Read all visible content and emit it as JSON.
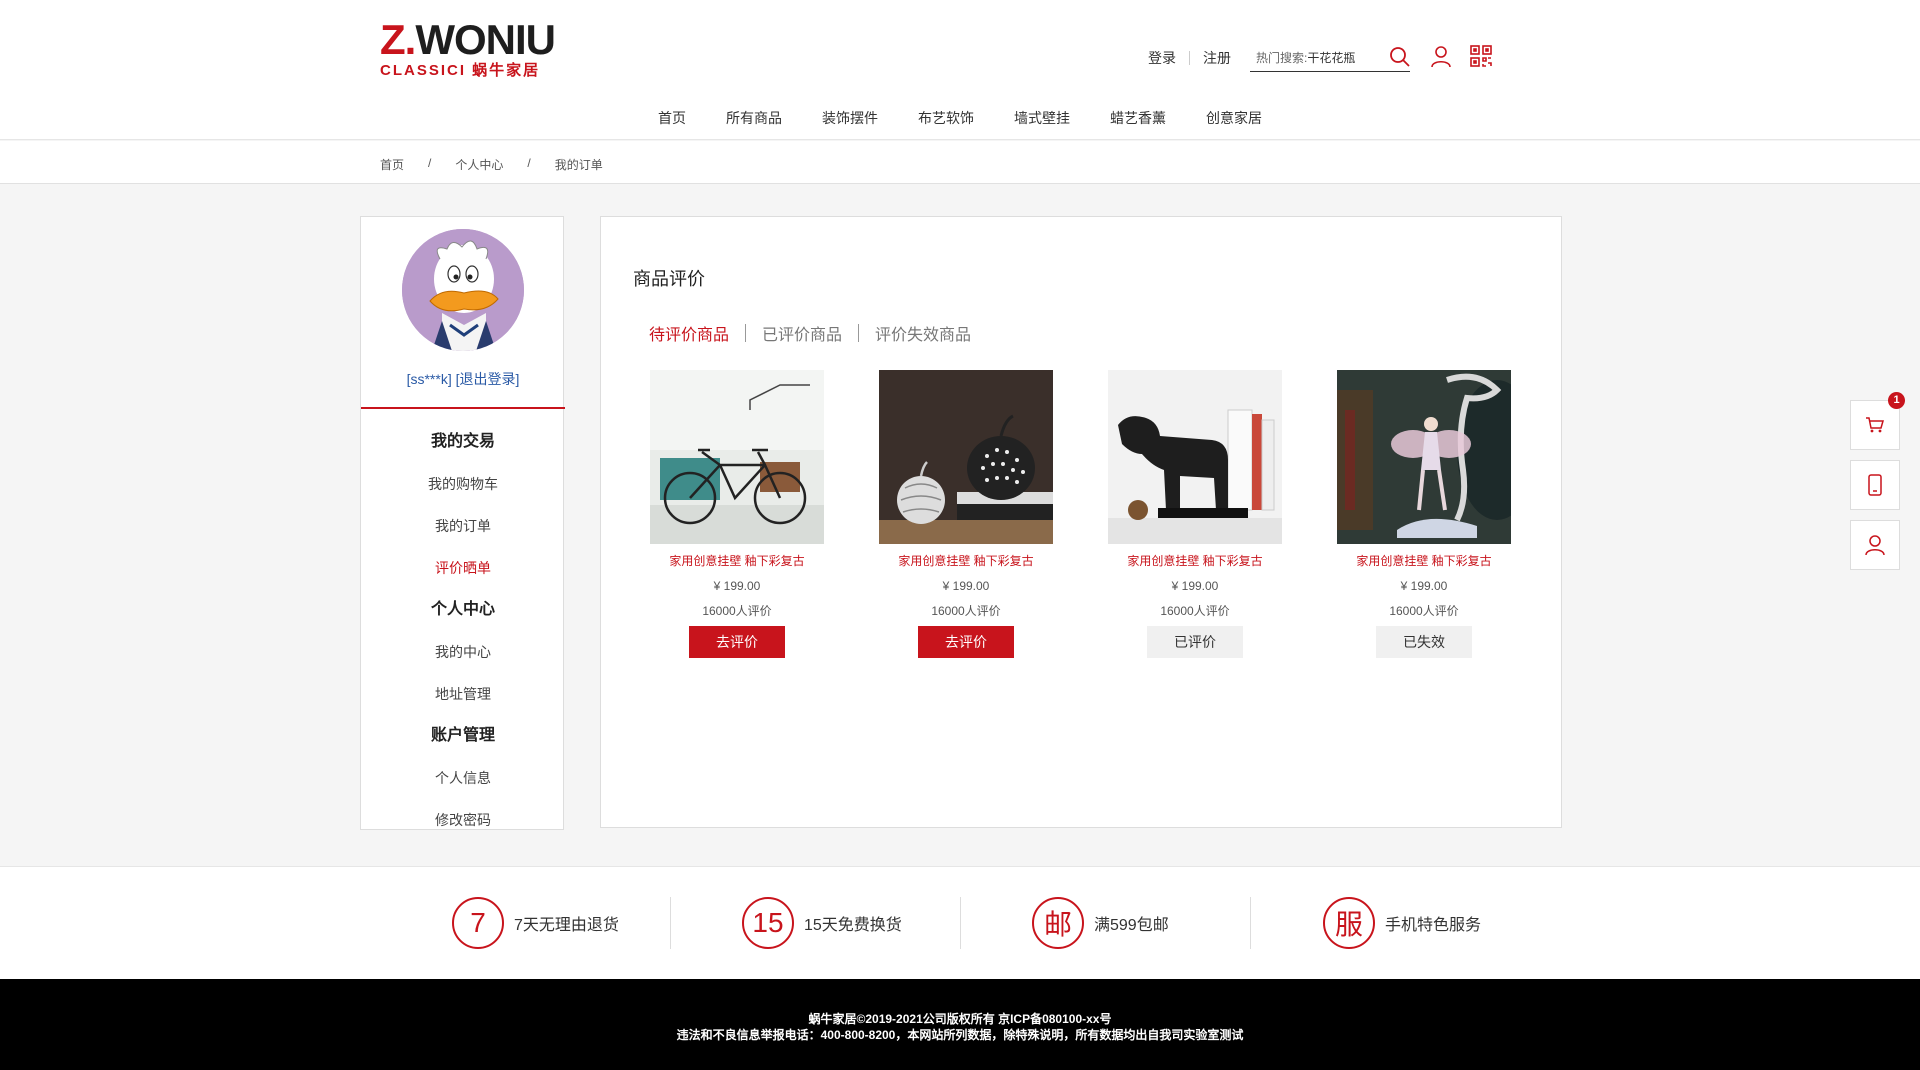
{
  "header": {
    "logo_main_z": "Z.",
    "logo_main_rest": "WONIU",
    "logo_sub": "CLASSICI 蜗牛家居",
    "login": "登录",
    "register": "注册",
    "search_hot_label": "热门搜索:",
    "search_keyword": "干花花瓶"
  },
  "nav": [
    "首页",
    "所有商品",
    "装饰摆件",
    "布艺软饰",
    "墙式壁挂",
    "蜡艺香薰",
    "创意家居"
  ],
  "breadcrumb": {
    "home": "首页",
    "sep": "/",
    "center": "个人中心",
    "current": "我的订单"
  },
  "sidebar": {
    "user": "[ss***k]",
    "logout": "[退出登录]",
    "groups": [
      {
        "title": "我的交易",
        "items": [
          "我的购物车",
          "我的订单",
          "评价晒单"
        ]
      },
      {
        "title": "个人中心",
        "items": [
          "我的中心",
          "地址管理"
        ]
      },
      {
        "title": "账户管理",
        "items": [
          "个人信息",
          "修改密码"
        ]
      }
    ],
    "active_item": "评价晒单"
  },
  "main": {
    "title": "商品评价",
    "tabs": [
      "待评价商品",
      "已评价商品",
      "评价失效商品"
    ],
    "active_tab": 0,
    "products": [
      {
        "name": "家用创意挂壁 釉下彩复古",
        "price": "¥ 199.00",
        "reviews": "16000人评价",
        "button": "去评价",
        "button_style": "red"
      },
      {
        "name": "家用创意挂壁 釉下彩复古",
        "price": "¥ 199.00",
        "reviews": "16000人评价",
        "button": "去评价",
        "button_style": "red"
      },
      {
        "name": "家用创意挂壁 釉下彩复古",
        "price": "¥ 199.00",
        "reviews": "16000人评价",
        "button": "已评价",
        "button_style": "gray"
      },
      {
        "name": "家用创意挂壁 釉下彩复古",
        "price": "¥ 199.00",
        "reviews": "16000人评价",
        "button": "已失效",
        "button_style": "gray"
      }
    ]
  },
  "float": {
    "cart_badge": "1"
  },
  "services": [
    {
      "icon": "7",
      "label": "7天无理由退货"
    },
    {
      "icon": "15",
      "label": "15天免费换货"
    },
    {
      "icon": "邮",
      "label": "满599包邮"
    },
    {
      "icon": "服",
      "label": "手机特色服务"
    }
  ],
  "footer": {
    "line1": "蜗牛家居©2019-2021公司版权所有 京ICP备080100-xx号",
    "line2": "违法和不良信息举报电话：400-800-8200，本网站所列数据，除特殊说明，所有数据均出自我司实验室测试"
  },
  "colors": {
    "accent": "#c8141c",
    "link": "#2a5aa6",
    "footer_bg": "#000000"
  }
}
